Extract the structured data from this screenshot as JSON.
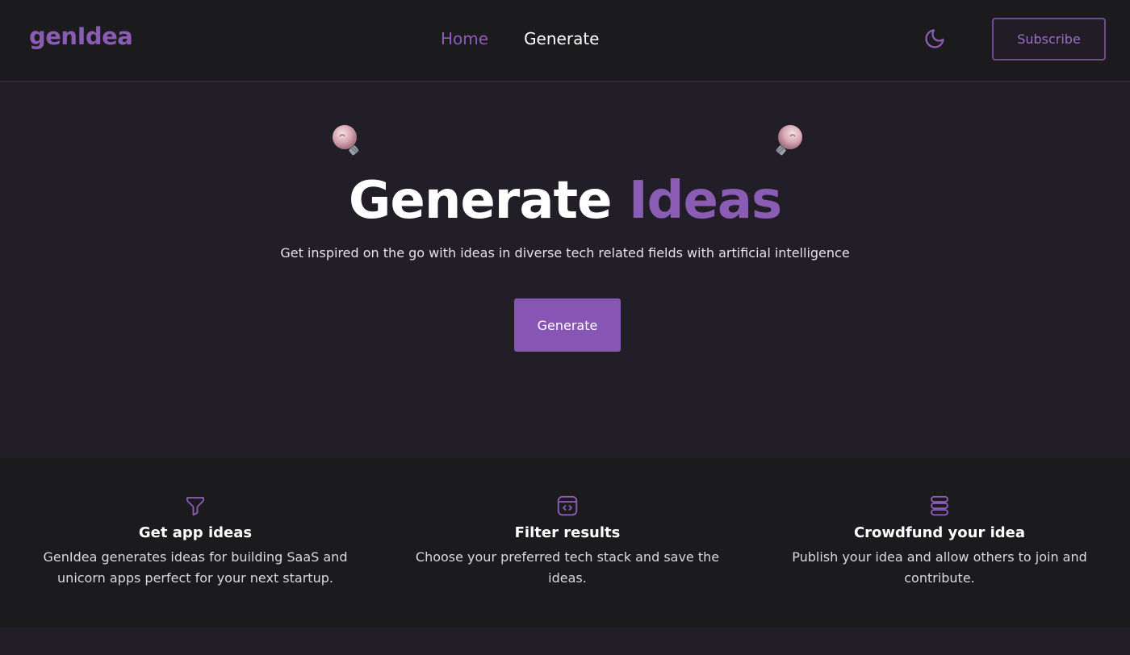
{
  "header": {
    "logo": "genIdea",
    "nav": [
      {
        "label": "Home"
      },
      {
        "label": "Generate"
      }
    ],
    "theme_icon": "moon-icon",
    "subscribe_label": "Subscribe"
  },
  "hero": {
    "title_part1": "Generate",
    "title_part2": "Ideas",
    "subtitle": "Get inspired on the go with ideas in diverse tech related fields with artificial intelligence",
    "button_label": "Generate",
    "decor_icons": [
      "lightbulb-icon",
      "lightbulb-icon"
    ]
  },
  "features": [
    {
      "icon": "filter-icon",
      "title": "Get app ideas",
      "desc": "GenIdea generates ideas for building SaaS and unicorn apps perfect for your next startup."
    },
    {
      "icon": "code-browser-icon",
      "title": "Filter results",
      "desc": "Choose your preferred tech stack and save the ideas."
    },
    {
      "icon": "stack-icon",
      "title": "Crowdfund your idea",
      "desc": "Publish your idea and allow others to join and contribute."
    }
  ],
  "colors": {
    "accent": "#8b5cb3",
    "button": "#8755b4",
    "background": "#221e27",
    "header_bg": "#1b1b1d"
  }
}
